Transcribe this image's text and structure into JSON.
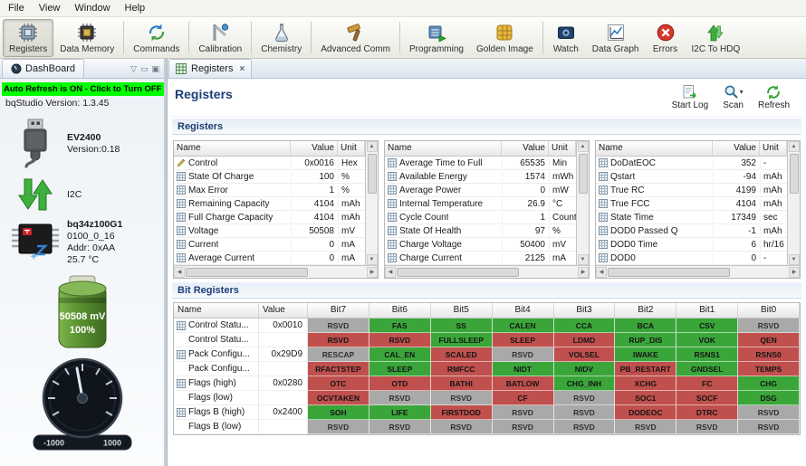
{
  "colors": {
    "bit_set": "#3aa63a",
    "bit_clear": "#c0504d",
    "bit_rsvd": "#a9a9a9",
    "banner_green": "#00ff00",
    "heading_blue": "#1c3e77"
  },
  "menu": {
    "items": [
      {
        "label": "File"
      },
      {
        "label": "View"
      },
      {
        "label": "Window"
      },
      {
        "label": "Help"
      }
    ]
  },
  "toolbar": {
    "items": [
      {
        "id": "registers",
        "label": "Registers",
        "icon": "chip-icon",
        "selected": true,
        "group_end": false
      },
      {
        "id": "data-memory",
        "label": "Data Memory",
        "icon": "memory-chip-icon",
        "selected": false,
        "group_end": true
      },
      {
        "id": "commands",
        "label": "Commands",
        "icon": "sync-arrows-icon",
        "selected": false,
        "group_end": true
      },
      {
        "id": "calibration",
        "label": "Calibration",
        "icon": "caliper-icon",
        "selected": false,
        "group_end": true
      },
      {
        "id": "chemistry",
        "label": "Chemistry",
        "icon": "flask-icon",
        "selected": false,
        "group_end": true
      },
      {
        "id": "advanced-comm",
        "label": "Advanced Comm",
        "icon": "hammer-icon",
        "selected": false,
        "group_end": true
      },
      {
        "id": "programming",
        "label": "Programming",
        "icon": "program-chip-icon",
        "selected": false,
        "group_end": false
      },
      {
        "id": "golden-image",
        "label": "Golden Image",
        "icon": "golden-chip-icon",
        "selected": false,
        "group_end": true
      },
      {
        "id": "watch",
        "label": "Watch",
        "icon": "watch-icon",
        "selected": false,
        "group_end": false
      },
      {
        "id": "data-graph",
        "label": "Data Graph",
        "icon": "graph-icon",
        "selected": false,
        "group_end": false
      },
      {
        "id": "errors",
        "label": "Errors",
        "icon": "error-icon",
        "selected": false,
        "group_end": false
      },
      {
        "id": "i2c-to-hdq",
        "label": "I2C To HDQ",
        "icon": "hdq-arrows-icon",
        "selected": false,
        "group_end": false
      }
    ]
  },
  "dashboard": {
    "tab_title": "DashBoard",
    "auto_refresh_banner": "Auto Refresh is ON - Click to Turn OFF",
    "version_line": "bqStudio Version:  1.3.45",
    "adapter_name": "EV2400",
    "adapter_version": "Version:0.18",
    "bus_label": "I2C",
    "device_name": "bq34z100G1",
    "device_fw": "0100_0_16",
    "device_addr": "Addr: 0xAA",
    "device_temp": "25.7 °C",
    "battery_voltage": "50508 mV",
    "battery_soc": "100%",
    "gauge_min": "-1000",
    "gauge_max": "1000"
  },
  "main": {
    "tab_title": "Registers",
    "page_title": "Registers",
    "section_registers": "Registers",
    "section_bit_registers": "Bit Registers",
    "actions": [
      {
        "id": "start-log",
        "label": "Start Log",
        "icon": "log-icon",
        "has_dropdown": false
      },
      {
        "id": "scan",
        "label": "Scan",
        "icon": "scan-icon",
        "has_dropdown": true
      },
      {
        "id": "refresh",
        "label": "Refresh",
        "icon": "refresh-icon",
        "has_dropdown": false
      }
    ]
  },
  "register_tables": [
    {
      "columns": [
        "Name",
        "Value",
        "Unit"
      ],
      "rows": [
        {
          "name": "Control",
          "value": "0x0016",
          "unit": "Hex",
          "editable": true
        },
        {
          "name": "State Of Charge",
          "value": "100",
          "unit": "%",
          "editable": false
        },
        {
          "name": "Max Error",
          "value": "1",
          "unit": "%",
          "editable": false
        },
        {
          "name": "Remaining Capacity",
          "value": "4104",
          "unit": "mAh",
          "editable": false
        },
        {
          "name": "Full Charge Capacity",
          "value": "4104",
          "unit": "mAh",
          "editable": false
        },
        {
          "name": "Voltage",
          "value": "50508",
          "unit": "mV",
          "editable": false
        },
        {
          "name": "Current",
          "value": "0",
          "unit": "mA",
          "editable": false
        },
        {
          "name": "Average Current",
          "value": "0",
          "unit": "mA",
          "editable": false
        }
      ]
    },
    {
      "columns": [
        "Name",
        "Value",
        "Unit"
      ],
      "rows": [
        {
          "name": "Average Time to Full",
          "value": "65535",
          "unit": "Min",
          "editable": false
        },
        {
          "name": "Available Energy",
          "value": "1574",
          "unit": "mWh",
          "editable": false
        },
        {
          "name": "Average Power",
          "value": "0",
          "unit": "mW",
          "editable": false
        },
        {
          "name": "Internal Temperature",
          "value": "26.9",
          "unit": "°C",
          "editable": false
        },
        {
          "name": "Cycle Count",
          "value": "1",
          "unit": "Counts",
          "editable": false
        },
        {
          "name": "State Of Health",
          "value": "97",
          "unit": "%",
          "editable": false
        },
        {
          "name": "Charge Voltage",
          "value": "50400",
          "unit": "mV",
          "editable": false
        },
        {
          "name": "Charge Current",
          "value": "2125",
          "unit": "mA",
          "editable": false
        }
      ]
    },
    {
      "columns": [
        "Name",
        "Value",
        "Unit"
      ],
      "rows": [
        {
          "name": "DoDatEOC",
          "value": "352",
          "unit": "-",
          "editable": false
        },
        {
          "name": "Qstart",
          "value": "-94",
          "unit": "mAh",
          "editable": false
        },
        {
          "name": "True RC",
          "value": "4199",
          "unit": "mAh",
          "editable": false
        },
        {
          "name": "True FCC",
          "value": "4104",
          "unit": "mAh",
          "editable": false
        },
        {
          "name": "State Time",
          "value": "17349",
          "unit": "sec",
          "editable": false
        },
        {
          "name": "DOD0 Passed Q",
          "value": "-1",
          "unit": "mAh",
          "editable": false
        },
        {
          "name": "DOD0 Time",
          "value": "6",
          "unit": "hr/16",
          "editable": false
        },
        {
          "name": "DOD0",
          "value": "0",
          "unit": "-",
          "editable": false
        }
      ]
    }
  ],
  "bit_table": {
    "columns": [
      "Name",
      "Value",
      "Bit7",
      "Bit6",
      "Bit5",
      "Bit4",
      "Bit3",
      "Bit2",
      "Bit1",
      "Bit0"
    ],
    "rows": [
      {
        "name": "Control Statu...",
        "value": "0x0010",
        "icon": true,
        "bits": [
          {
            "label": "RSVD",
            "state": "rsvd"
          },
          {
            "label": "FAS",
            "state": "set"
          },
          {
            "label": "SS",
            "state": "set"
          },
          {
            "label": "CALEN",
            "state": "set"
          },
          {
            "label": "CCA",
            "state": "set"
          },
          {
            "label": "BCA",
            "state": "set"
          },
          {
            "label": "CSV",
            "state": "set"
          },
          {
            "label": "RSVD",
            "state": "rsvd"
          }
        ]
      },
      {
        "name": "Control Statu...",
        "value": "",
        "icon": false,
        "bits": [
          {
            "label": "RSVD",
            "state": "clear"
          },
          {
            "label": "RSVD",
            "state": "clear"
          },
          {
            "label": "FULLSLEEP",
            "state": "set"
          },
          {
            "label": "SLEEP",
            "state": "clear"
          },
          {
            "label": "LDMD",
            "state": "clear"
          },
          {
            "label": "RUP_DIS",
            "state": "set"
          },
          {
            "label": "VOK",
            "state": "set"
          },
          {
            "label": "QEN",
            "state": "clear"
          }
        ]
      },
      {
        "name": "Pack Configu...",
        "value": "0x29D9",
        "icon": true,
        "bits": [
          {
            "label": "RESCAP",
            "state": "rsvd"
          },
          {
            "label": "CAL_EN",
            "state": "set"
          },
          {
            "label": "SCALED",
            "state": "clear"
          },
          {
            "label": "RSVD",
            "state": "rsvd"
          },
          {
            "label": "VOLSEL",
            "state": "clear"
          },
          {
            "label": "IWAKE",
            "state": "set"
          },
          {
            "label": "RSNS1",
            "state": "set"
          },
          {
            "label": "RSNS0",
            "state": "clear"
          }
        ]
      },
      {
        "name": "Pack Configu...",
        "value": "",
        "icon": false,
        "bits": [
          {
            "label": "RFACTSTEP",
            "state": "clear"
          },
          {
            "label": "SLEEP",
            "state": "set"
          },
          {
            "label": "RMFCC",
            "state": "clear"
          },
          {
            "label": "NIDT",
            "state": "set"
          },
          {
            "label": "NIDV",
            "state": "set"
          },
          {
            "label": "PB_RESTART",
            "state": "clear"
          },
          {
            "label": "GNDSEL",
            "state": "set"
          },
          {
            "label": "TEMPS",
            "state": "clear"
          }
        ]
      },
      {
        "name": "Flags (high)",
        "value": "0x0280",
        "icon": true,
        "bits": [
          {
            "label": "OTC",
            "state": "clear"
          },
          {
            "label": "OTD",
            "state": "clear"
          },
          {
            "label": "BATHI",
            "state": "clear"
          },
          {
            "label": "BATLOW",
            "state": "clear"
          },
          {
            "label": "CHG_INH",
            "state": "set"
          },
          {
            "label": "XCHG",
            "state": "clear"
          },
          {
            "label": "FC",
            "state": "clear"
          },
          {
            "label": "CHG",
            "state": "set"
          }
        ]
      },
      {
        "name": "Flags (low)",
        "value": "",
        "icon": false,
        "bits": [
          {
            "label": "OCVTAKEN",
            "state": "clear"
          },
          {
            "label": "RSVD",
            "state": "rsvd"
          },
          {
            "label": "RSVD",
            "state": "rsvd"
          },
          {
            "label": "CF",
            "state": "clear"
          },
          {
            "label": "RSVD",
            "state": "rsvd"
          },
          {
            "label": "SOC1",
            "state": "clear"
          },
          {
            "label": "SOCF",
            "state": "clear"
          },
          {
            "label": "DSG",
            "state": "set"
          }
        ]
      },
      {
        "name": "Flags B (high)",
        "value": "0x2400",
        "icon": true,
        "bits": [
          {
            "label": "SOH",
            "state": "set"
          },
          {
            "label": "LIFE",
            "state": "set"
          },
          {
            "label": "FIRSTDOD",
            "state": "clear"
          },
          {
            "label": "RSVD",
            "state": "rsvd"
          },
          {
            "label": "RSVD",
            "state": "rsvd"
          },
          {
            "label": "DODEOC",
            "state": "clear"
          },
          {
            "label": "DTRC",
            "state": "clear"
          },
          {
            "label": "RSVD",
            "state": "rsvd"
          }
        ]
      },
      {
        "name": "Flags B (low)",
        "value": "",
        "icon": false,
        "bits": [
          {
            "label": "RSVD",
            "state": "rsvd"
          },
          {
            "label": "RSVD",
            "state": "rsvd"
          },
          {
            "label": "RSVD",
            "state": "rsvd"
          },
          {
            "label": "RSVD",
            "state": "rsvd"
          },
          {
            "label": "RSVD",
            "state": "rsvd"
          },
          {
            "label": "RSVD",
            "state": "rsvd"
          },
          {
            "label": "RSVD",
            "state": "rsvd"
          },
          {
            "label": "RSVD",
            "state": "rsvd"
          }
        ]
      }
    ]
  }
}
